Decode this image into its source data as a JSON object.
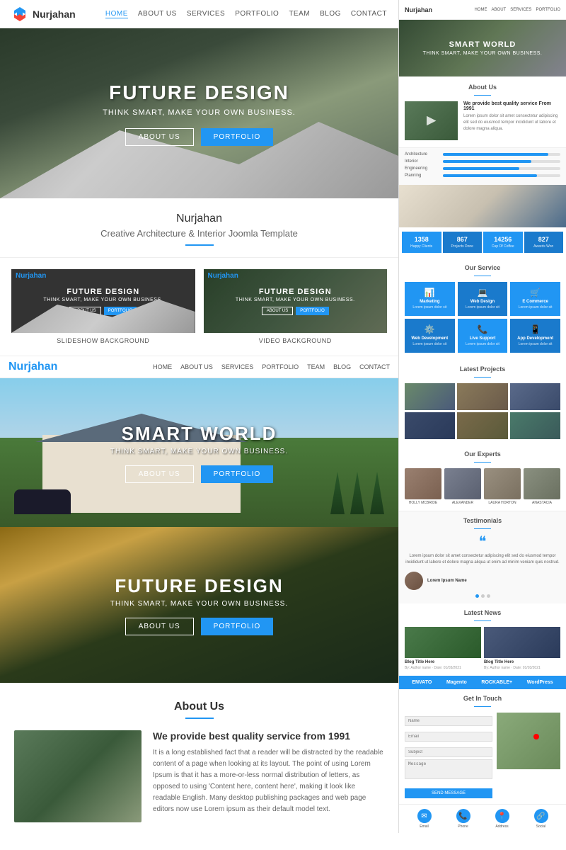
{
  "site": {
    "name": "Nurjahan",
    "tagline": "Creative Architecture & Interior Joomla Template"
  },
  "nav": {
    "logo": "Nurjahan",
    "links": [
      "HOME",
      "ABOUT US",
      "SERVICES",
      "PORTFOLIO",
      "TEAM",
      "BLOG",
      "CONTACT"
    ]
  },
  "hero1": {
    "title": "FUTURE DESIGN",
    "subtitle": "THINK SMART, MAKE YOUR OWN BUSINESS.",
    "btn1": "ABOUT US",
    "btn2": "PORTFOLIO"
  },
  "hero2": {
    "title": "SMART WORLD",
    "subtitle": "THINK SMART, MAKE YOUR OWN BUSINESS.",
    "btn1": "ABOUT US",
    "btn2": "PORTFOLIO"
  },
  "hero3": {
    "title": "FUTURE DESIGN",
    "subtitle": "THINK SMART, MAKE YOUR OWN BUSINESS.",
    "btn1": "ABOUT US",
    "btn2": "PORTFOLIO"
  },
  "preview": {
    "card1": {
      "title": "FUTURE DESIGN",
      "subtitle": "THINK SMART, MAKE YOUR OWN BUSINESS.",
      "label": "SLIDESHOW BACKGROUND"
    },
    "card2": {
      "title": "FUTURE DESIGN",
      "subtitle": "THINK SMART, MAKE YOUR OWN BUSINESS.",
      "label": "VIDEO BACKGROUND"
    }
  },
  "about": {
    "section_title": "About Us",
    "heading": "We provide best quality service from 1991",
    "text": "It is a long established fact that a reader will be distracted by the readable content of a page when looking at its layout. The point of using Lorem Ipsum is that it has a more-or-less normal distribution of letters, as opposed to using 'Content here, content here', making it look like readable English. Many desktop publishing packages and web page editors now use Lorem ipsum as their default model text."
  },
  "right_panel": {
    "hero": {
      "title": "SMART WORLD",
      "subtitle": "THINK SMART, MAKE YOUR OWN BUSINESS."
    },
    "about_title": "About Us",
    "about_heading": "We provide best quality service From 1991",
    "about_text": "Lorem ipsum dolor sit amet consectetur adipiscing elit sed do eiusmod tempor incididunt ut labore et dolore magna aliqua.",
    "stats_bars": [
      {
        "label": "Architecture",
        "pct": 90
      },
      {
        "label": "Interior",
        "pct": 75
      },
      {
        "label": "Engineering",
        "pct": 65
      },
      {
        "label": "Planning",
        "pct": 80
      }
    ],
    "counters": [
      {
        "num": "1358",
        "label": "Happy Clients"
      },
      {
        "num": "867",
        "label": "Projects Done"
      },
      {
        "num": "14256",
        "label": "Cup Of Coffee"
      },
      {
        "num": "827",
        "label": "Awards Won"
      }
    ],
    "service_title": "Our Service",
    "services": [
      {
        "icon": "📊",
        "name": "Marketing",
        "desc": "Lorem ipsum dolor sit"
      },
      {
        "icon": "💻",
        "name": "Web Design",
        "desc": "Lorem ipsum dolor sit"
      },
      {
        "icon": "🛒",
        "name": "E Commerce",
        "desc": "Lorem ipsum dolor sit"
      },
      {
        "icon": "⚙️",
        "name": "Web Development",
        "desc": "Lorem ipsum dolor sit"
      },
      {
        "icon": "📞",
        "name": "Live Support",
        "desc": "Lorem ipsum dolor sit"
      },
      {
        "icon": "📱",
        "name": "App Development",
        "desc": "Lorem ipsum dolor sit"
      }
    ],
    "projects_title": "Latest Projects",
    "experts_title": "Our Experts",
    "experts": [
      {
        "name": "HOLLY MCBRIDE"
      },
      {
        "name": "ALEXANDER"
      },
      {
        "name": "LAURA HORTON"
      },
      {
        "name": "ANASTACIA"
      }
    ],
    "testimonials_title": "Testimonials",
    "testimonial_text": "Lorem ipsum dolor sit amet consectetur adipiscing elit sed do eiusmod tempor incididunt ut labore et dolore magna aliqua ut enim ad minim veniam quis nostrud.",
    "author_name": "Lorem Ipsum Name",
    "news_title": "Latest News",
    "news": [
      {
        "title": "Blog Title Here",
        "meta": "By: Author name · Date: 01/03/2021"
      },
      {
        "title": "Blog Title Here",
        "meta": "By: Author name · Date: 01/03/2021"
      }
    ],
    "partners": [
      "ENVATO",
      "Magento",
      "ROCKABLE+",
      "WordPress"
    ],
    "contact_title": "Get In Touch",
    "footer_icons": [
      "✉",
      "📞",
      "📍",
      "🔗"
    ]
  }
}
